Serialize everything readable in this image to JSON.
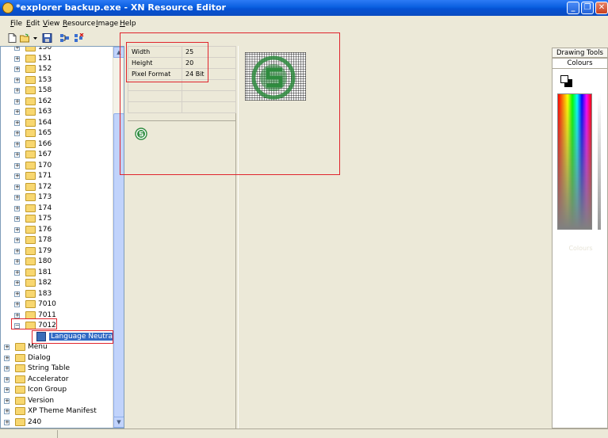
{
  "window": {
    "title": "*explorer backup.exe - XN Resource Editor",
    "controls": [
      "_",
      "❐",
      "✕"
    ]
  },
  "menu": [
    "File",
    "Edit",
    "View",
    "Resource",
    "Image",
    "Help"
  ],
  "toolbar_icons": [
    "new-file-icon",
    "open-folder-icon",
    "dropdown-arrow-icon",
    "save-icon",
    "add-resource-icon",
    "delete-resource-icon"
  ],
  "tree": {
    "bitmap_items": [
      "150",
      "151",
      "152",
      "153",
      "158",
      "162",
      "163",
      "164",
      "165",
      "166",
      "167",
      "170",
      "171",
      "172",
      "173",
      "174",
      "175",
      "176",
      "178",
      "179",
      "180",
      "181",
      "182",
      "183",
      "7010",
      "7011"
    ],
    "expanded_item": "7012",
    "selected_child": "Language Neutral",
    "root_items": [
      "Menu",
      "Dialog",
      "String Table",
      "Accelerator",
      "Icon Group",
      "Version",
      "XP Theme Manifest",
      "240"
    ]
  },
  "properties": [
    {
      "key": "Width",
      "value": "25"
    },
    {
      "key": "Height",
      "value": "20"
    },
    {
      "key": "Pixel Format",
      "value": "24 Bit"
    }
  ],
  "right_panel": {
    "tab_drawing_tools": "Drawing Tools",
    "tab_colours": "Colours",
    "faded_label": "Colours"
  },
  "colors": {
    "highlight": "#e0242c",
    "selection": "#316ac5",
    "icon_green": "#2e8b3e"
  }
}
